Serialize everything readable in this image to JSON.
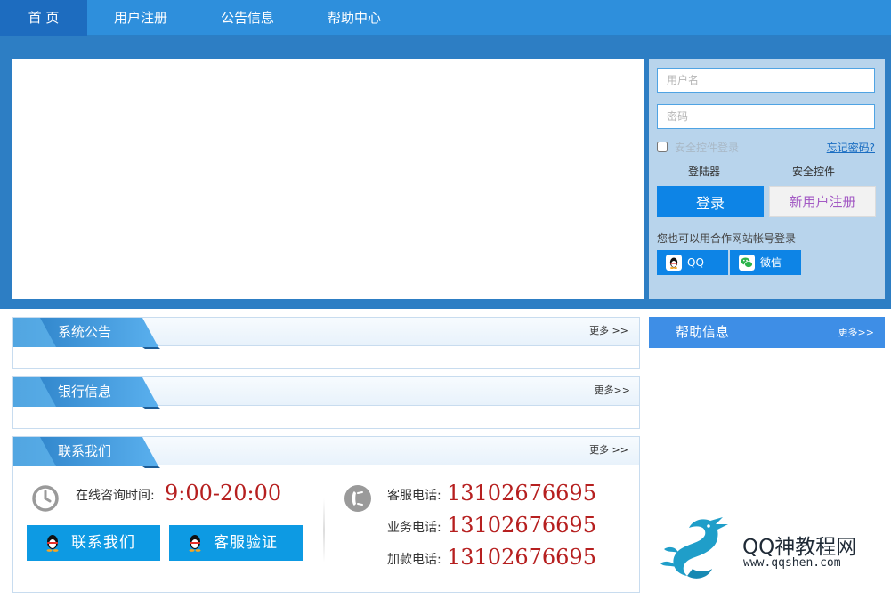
{
  "nav": {
    "items": [
      {
        "label": "首 页",
        "active": true
      },
      {
        "label": "用户注册",
        "active": false
      },
      {
        "label": "公告信息",
        "active": false
      },
      {
        "label": "帮助中心",
        "active": false
      }
    ]
  },
  "login": {
    "username_placeholder": "用户名",
    "password_placeholder": "密码",
    "secure_login_label": "安全控件登录",
    "forgot_password": "忘记密码?",
    "tools": [
      "登陆器",
      "安全控件"
    ],
    "login_button": "登录",
    "register_button": "新用户注册",
    "partner_text": "您也可以用合作网站帐号登录",
    "partners": [
      "QQ",
      "微信"
    ]
  },
  "panels": {
    "announcement": {
      "title": "系统公告",
      "more": "更多 >>"
    },
    "bank": {
      "title": "银行信息",
      "more": "更多>>"
    },
    "contact": {
      "title": "联系我们",
      "more": "更多 >>"
    }
  },
  "help": {
    "title": "帮助信息",
    "more": "更多>>"
  },
  "contact": {
    "online_label": "在线咨询时间:",
    "online_time": "9:00-20:00",
    "buttons": [
      "联系我们",
      "客服验证"
    ],
    "phones": [
      {
        "label": "客服电话:",
        "number": "13102676695"
      },
      {
        "label": "业务电话:",
        "number": "13102676695"
      },
      {
        "label": "加款电话:",
        "number": "13102676695"
      }
    ]
  },
  "watermark": {
    "title": "QQ神教程网",
    "url": "www.qqshen.com"
  },
  "colors": {
    "nav_bg": "#2e8fdc",
    "band_bg": "#2d7ec4",
    "accent": "#0d84e6",
    "phone_red": "#b61f1f"
  }
}
